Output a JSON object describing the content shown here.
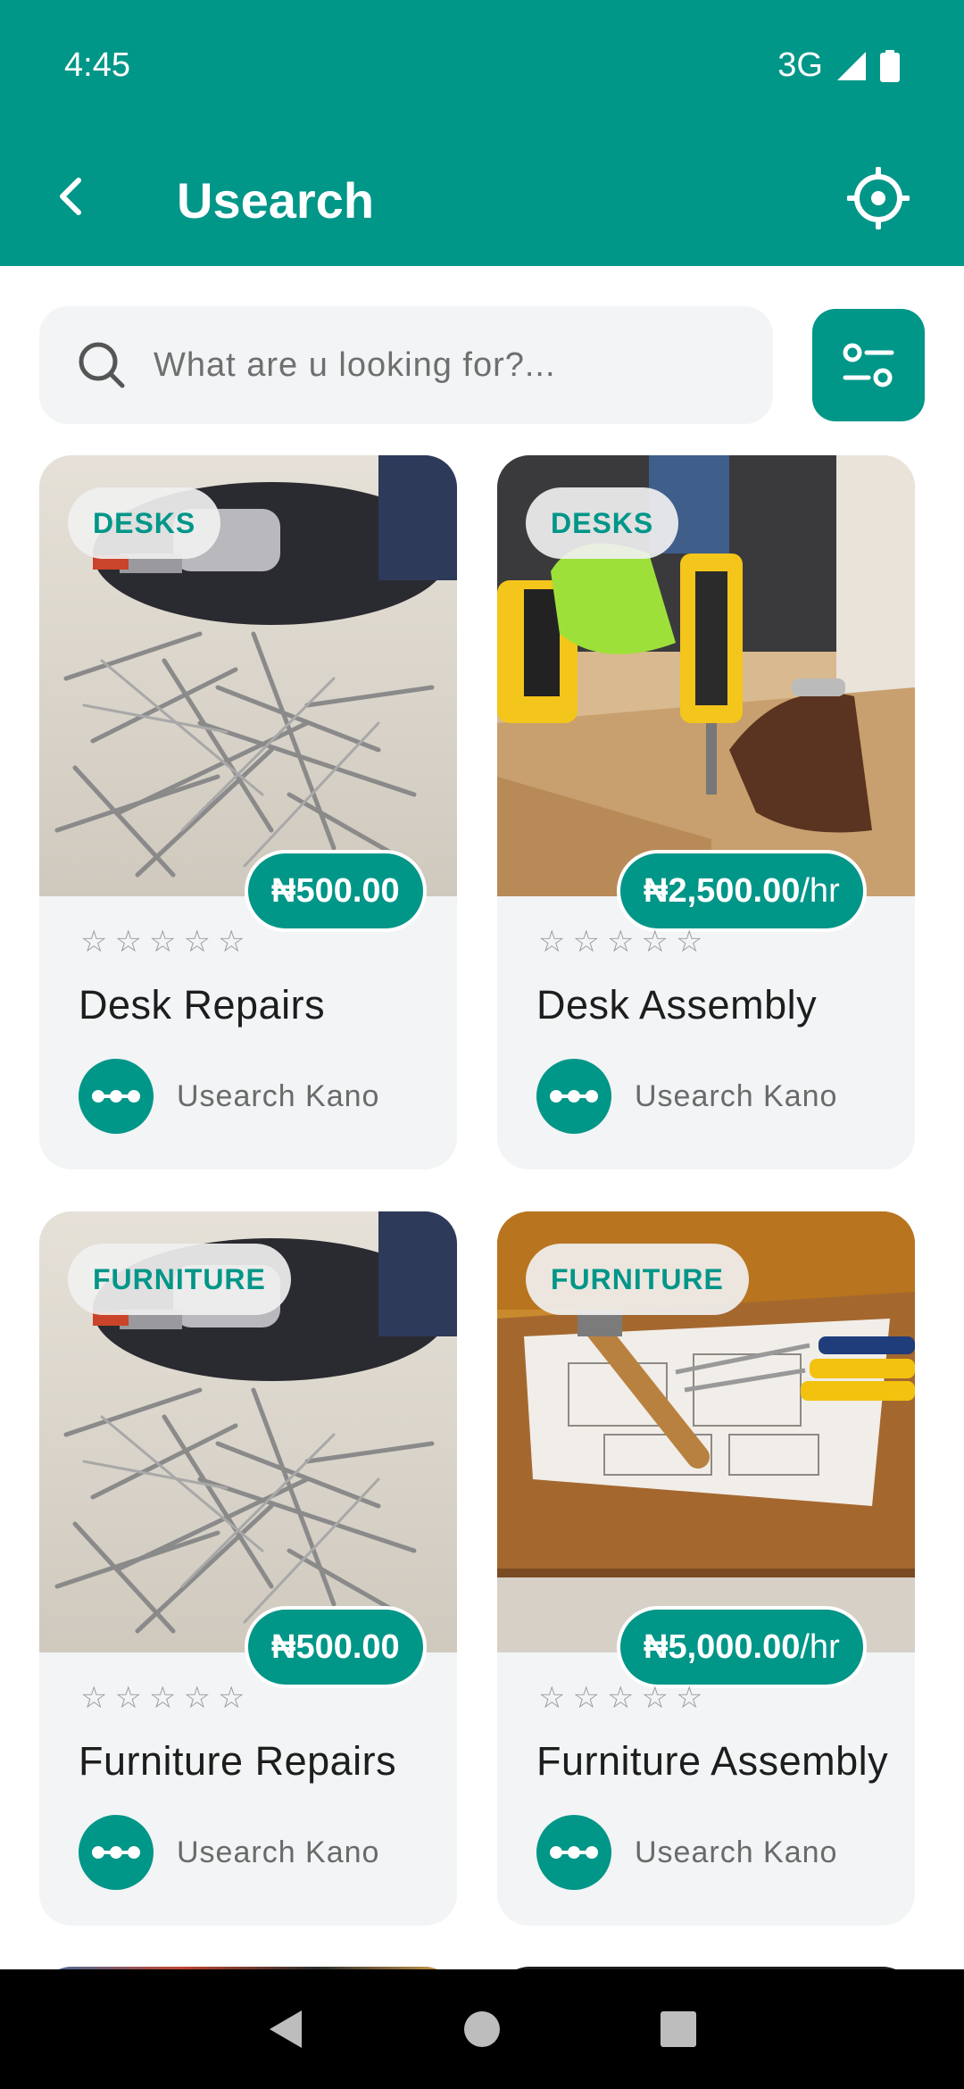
{
  "status_bar": {
    "time": "4:45",
    "network": "3G"
  },
  "app_bar": {
    "title": "Usearch"
  },
  "search": {
    "placeholder": "What are u looking for?..."
  },
  "colors": {
    "primary": "#009688",
    "card_bg": "#f2f4f5"
  },
  "listings": [
    {
      "category": "DESKS",
      "price": "₦500.00",
      "price_unit": "",
      "rating": 0,
      "title": "Desk Repairs",
      "seller": "Usearch Kano",
      "image": "screws-drill"
    },
    {
      "category": "DESKS",
      "price": "₦2,500.00",
      "price_unit": "/hr",
      "rating": 0,
      "title": "Desk Assembly",
      "seller": "Usearch Kano",
      "image": "drill-assembly"
    },
    {
      "category": "FURNITURE",
      "price": "₦500.00",
      "price_unit": "",
      "rating": 0,
      "title": "Furniture Repairs",
      "seller": "Usearch Kano",
      "image": "screws-drill"
    },
    {
      "category": "FURNITURE",
      "price": "₦5,000.00",
      "price_unit": "/hr",
      "rating": 0,
      "title": "Furniture Assembly",
      "seller": "Usearch Kano",
      "image": "hammer-tools"
    }
  ],
  "nav": {
    "back": "triangle-back-icon",
    "home": "circle-home-icon",
    "recents": "square-recents-icon"
  }
}
